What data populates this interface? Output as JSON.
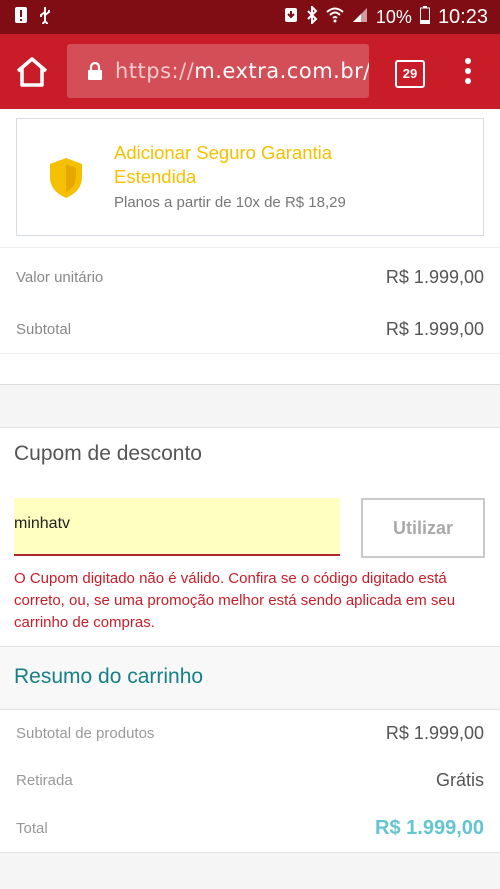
{
  "status_bar": {
    "battery": "10%",
    "time": "10:23"
  },
  "browser": {
    "url_scheme": "https://",
    "url_host": "m.extra.com.br/?",
    "tab_count": "29"
  },
  "warranty": {
    "title": "Adicionar Seguro Garantia Estendida",
    "subtitle": "Planos a partir de 10x de R$ 18,29"
  },
  "item": {
    "unit_label": "Valor unitário",
    "unit_value": "R$ 1.999,00",
    "subtotal_label": "Subtotal",
    "subtotal_value": "R$ 1.999,00"
  },
  "coupon": {
    "title": "Cupom de desconto",
    "input_value": "minhatv",
    "button_label": "Utilizar",
    "error": "O Cupom digitado não é válido. Confira se o código digitado está correto, ou, se uma promoção melhor está sendo aplicada em seu carrinho de compras."
  },
  "summary": {
    "title": "Resumo do carrinho",
    "rows": [
      {
        "label": "Subtotal de produtos",
        "value": "R$ 1.999,00"
      },
      {
        "label": "Retirada",
        "value": "Grátis"
      },
      {
        "label": "Total",
        "value": "R$ 1.999,00"
      }
    ]
  },
  "colors": {
    "brand_red": "#c81d28",
    "status_dark_red": "#7f0d13",
    "warranty_yellow": "#f5c000",
    "teal": "#177f86",
    "total_cyan": "#62c5cf"
  }
}
